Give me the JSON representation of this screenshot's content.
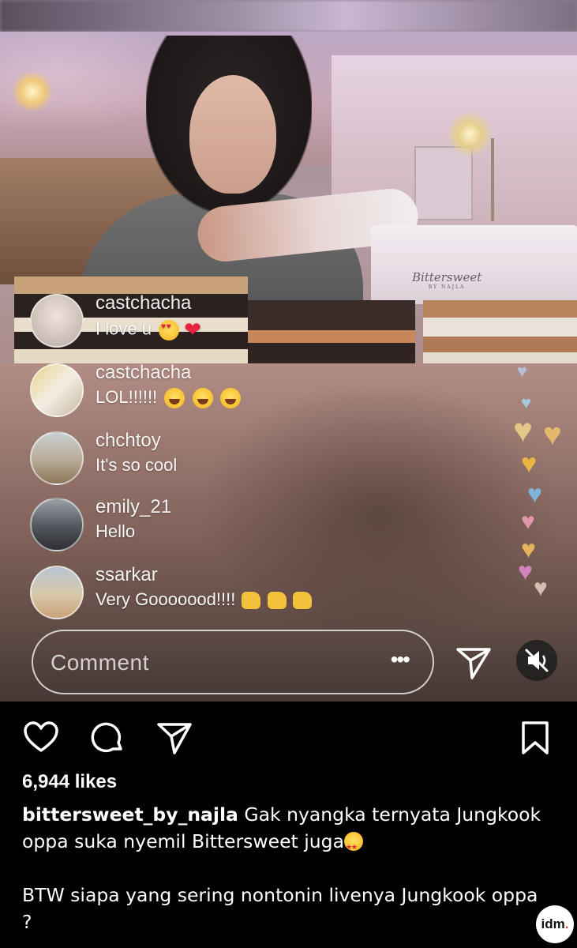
{
  "live": {
    "box_logo": "Bittersweet",
    "box_logo_sub": "BY NAJLA",
    "comments": [
      {
        "username": "castchacha",
        "text": "I love u",
        "emoji": [
          "heart-eyes",
          "red-heart"
        ]
      },
      {
        "username": "castchacha",
        "text": "LOL!!!!!!",
        "emoji": [
          "laughing",
          "laughing",
          "laughing"
        ]
      },
      {
        "username": "chchtoy",
        "text": "It's so cool",
        "emoji": []
      },
      {
        "username": "emily_21",
        "text": "Hello",
        "emoji": []
      },
      {
        "username": "ssarkar",
        "text": "Very Gooooood!!!!",
        "emoji": [
          "thumbs-up",
          "thumbs-up",
          "thumbs-up"
        ]
      }
    ],
    "comment_input": {
      "placeholder": "Comment",
      "more_label": "•••"
    },
    "send_icon": "send-icon",
    "mute_icon": "mute-icon"
  },
  "post": {
    "actions": {
      "like_icon": "heart-icon",
      "comment_icon": "comment-icon",
      "share_icon": "share-icon",
      "save_icon": "bookmark-icon"
    },
    "likes": "6,944 likes",
    "caption_user": "bittersweet_by_najla",
    "caption_line1": "Gak nyangka ternyata Jungkook oppa suka nyemil Bittersweet juga",
    "caption_line2": "BTW siapa yang sering nontonin livenya Jungkook oppa ?",
    "watermark": "idm."
  }
}
